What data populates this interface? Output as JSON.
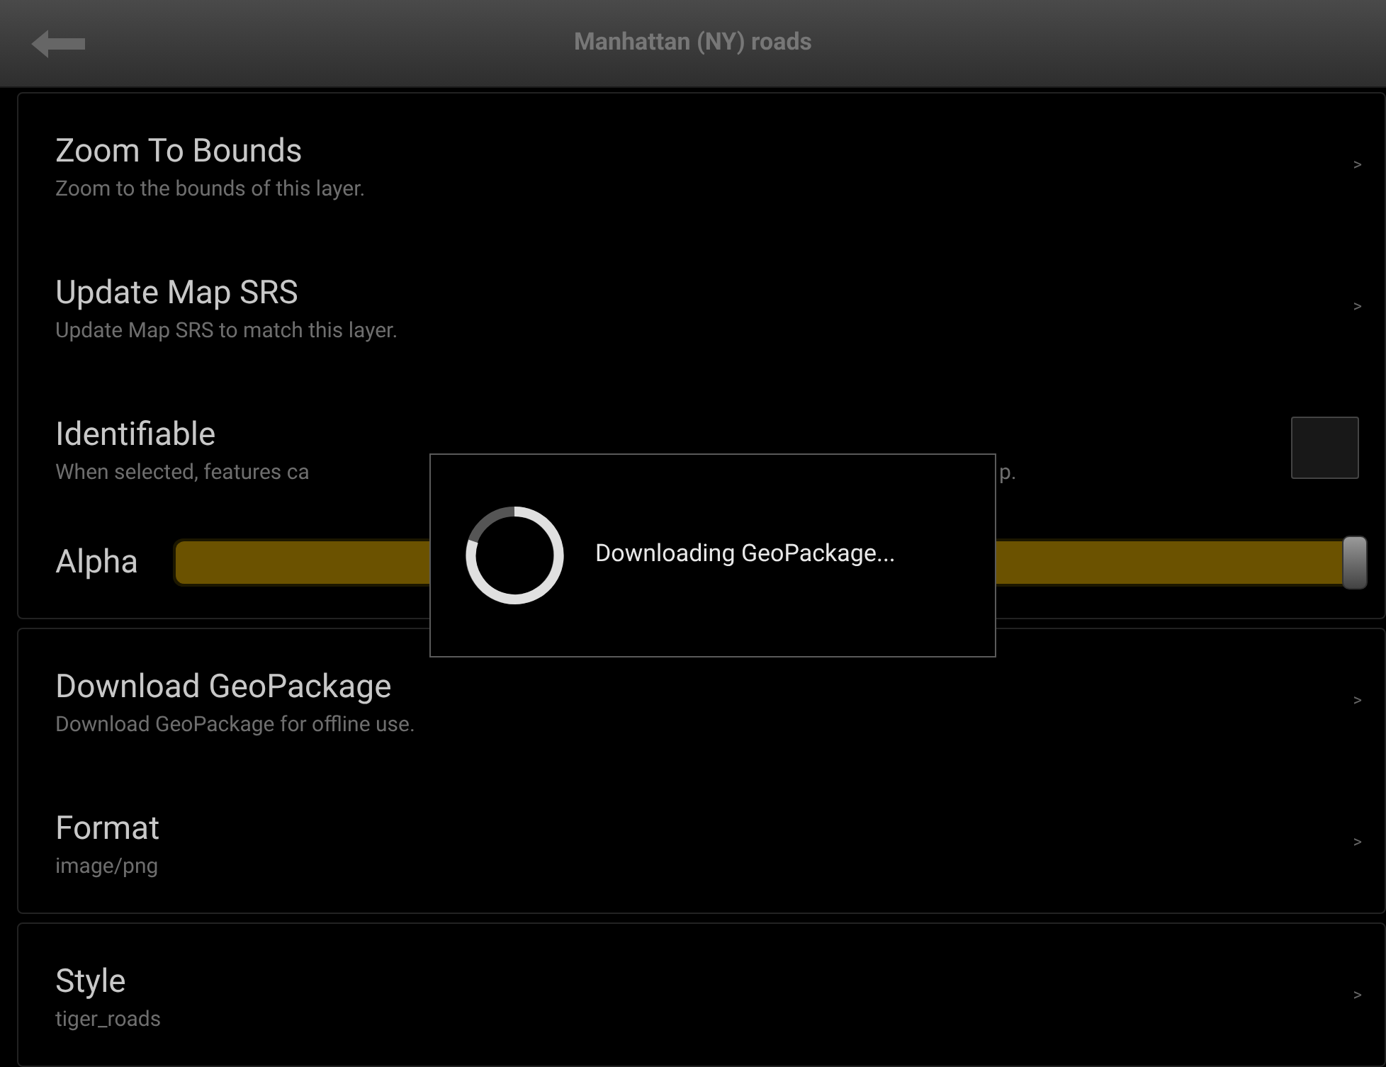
{
  "header": {
    "title": "Manhattan (NY) roads"
  },
  "sections": [
    {
      "items": [
        {
          "kind": "link",
          "title": "Zoom To Bounds",
          "subtitle": "Zoom to the bounds of this layer.",
          "chevron": ">"
        },
        {
          "kind": "link",
          "title": "Update Map SRS",
          "subtitle": "Update Map SRS to match this layer.",
          "chevron": ">"
        },
        {
          "kind": "checkbox",
          "title": "Identifiable",
          "subtitle_parts": [
            "When selected, features ca",
            "p."
          ],
          "checked": false
        },
        {
          "kind": "slider",
          "title": "Alpha",
          "level": 1
        }
      ]
    },
    {
      "items": [
        {
          "kind": "link",
          "title": "Download GeoPackage",
          "subtitle": "Download GeoPackage for offline use.",
          "chevron": ">"
        },
        {
          "kind": "link",
          "title": "Format",
          "subtitle": "image/png",
          "chevron": ">"
        }
      ]
    },
    {
      "items": [
        {
          "kind": "link",
          "title": "Style",
          "subtitle": "tiger_roads",
          "chevron": ">"
        }
      ]
    }
  ],
  "dialog": {
    "message": "Downloading GeoPackage..."
  }
}
